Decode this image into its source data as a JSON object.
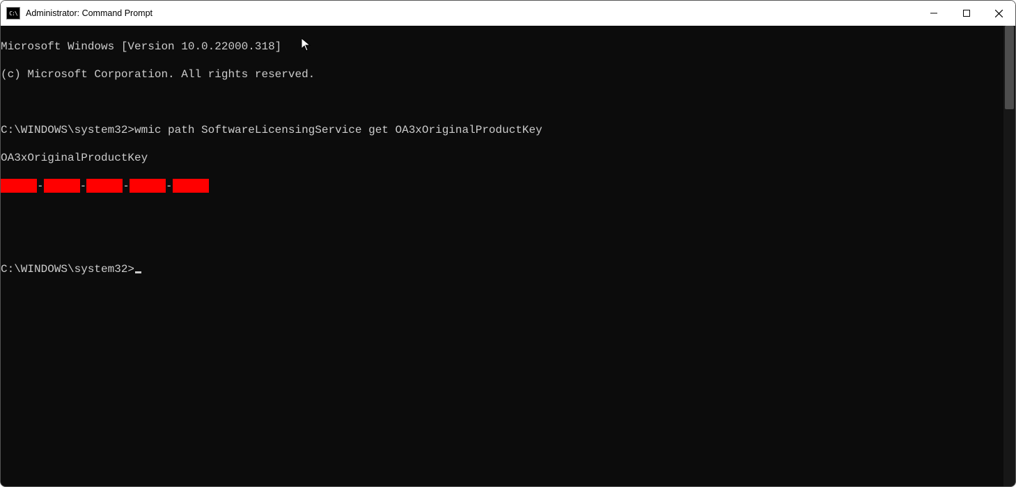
{
  "window": {
    "title": "Administrator: Command Prompt"
  },
  "terminal": {
    "banner_line1": "Microsoft Windows [Version 10.0.22000.318]",
    "banner_line2": "(c) Microsoft Corporation. All rights reserved.",
    "prompt1_path": "C:\\WINDOWS\\system32>",
    "command1": "wmic path SoftwareLicensingService get OA3xOriginalProductKey",
    "output_header": "OA3xOriginalProductKey",
    "key_dash": "-",
    "prompt2_path": "C:\\WINDOWS\\system32>"
  },
  "icons": {
    "app_icon_text": "C:\\"
  }
}
